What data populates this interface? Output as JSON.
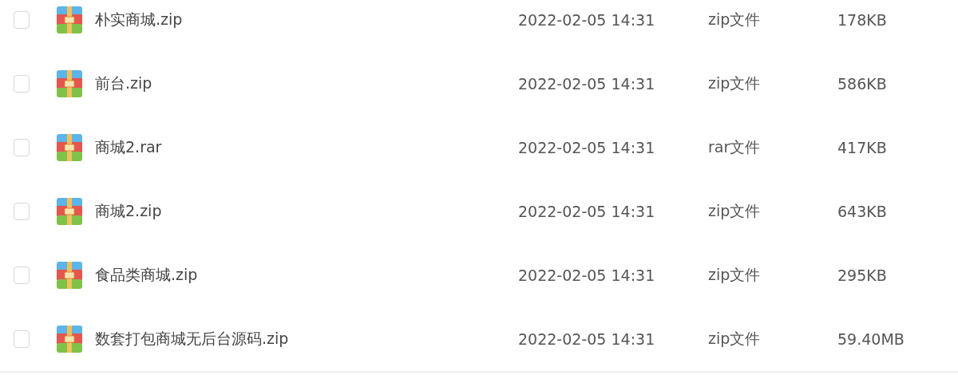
{
  "files": [
    {
      "name": "朴实商城.zip",
      "modified": "2022-02-05 14:31",
      "type": "zip文件",
      "size": "178KB",
      "checked": false
    },
    {
      "name": "前台.zip",
      "modified": "2022-02-05 14:31",
      "type": "zip文件",
      "size": "586KB",
      "checked": false
    },
    {
      "name": "商城2.rar",
      "modified": "2022-02-05 14:31",
      "type": "rar文件",
      "size": "417KB",
      "checked": false
    },
    {
      "name": "商城2.zip",
      "modified": "2022-02-05 14:31",
      "type": "zip文件",
      "size": "643KB",
      "checked": false
    },
    {
      "name": "食品类商城.zip",
      "modified": "2022-02-05 14:31",
      "type": "zip文件",
      "size": "295KB",
      "checked": false
    },
    {
      "name": "数套打包商城无后台源码.zip",
      "modified": "2022-02-05 14:31",
      "type": "zip文件",
      "size": "59.40MB",
      "checked": false
    }
  ]
}
